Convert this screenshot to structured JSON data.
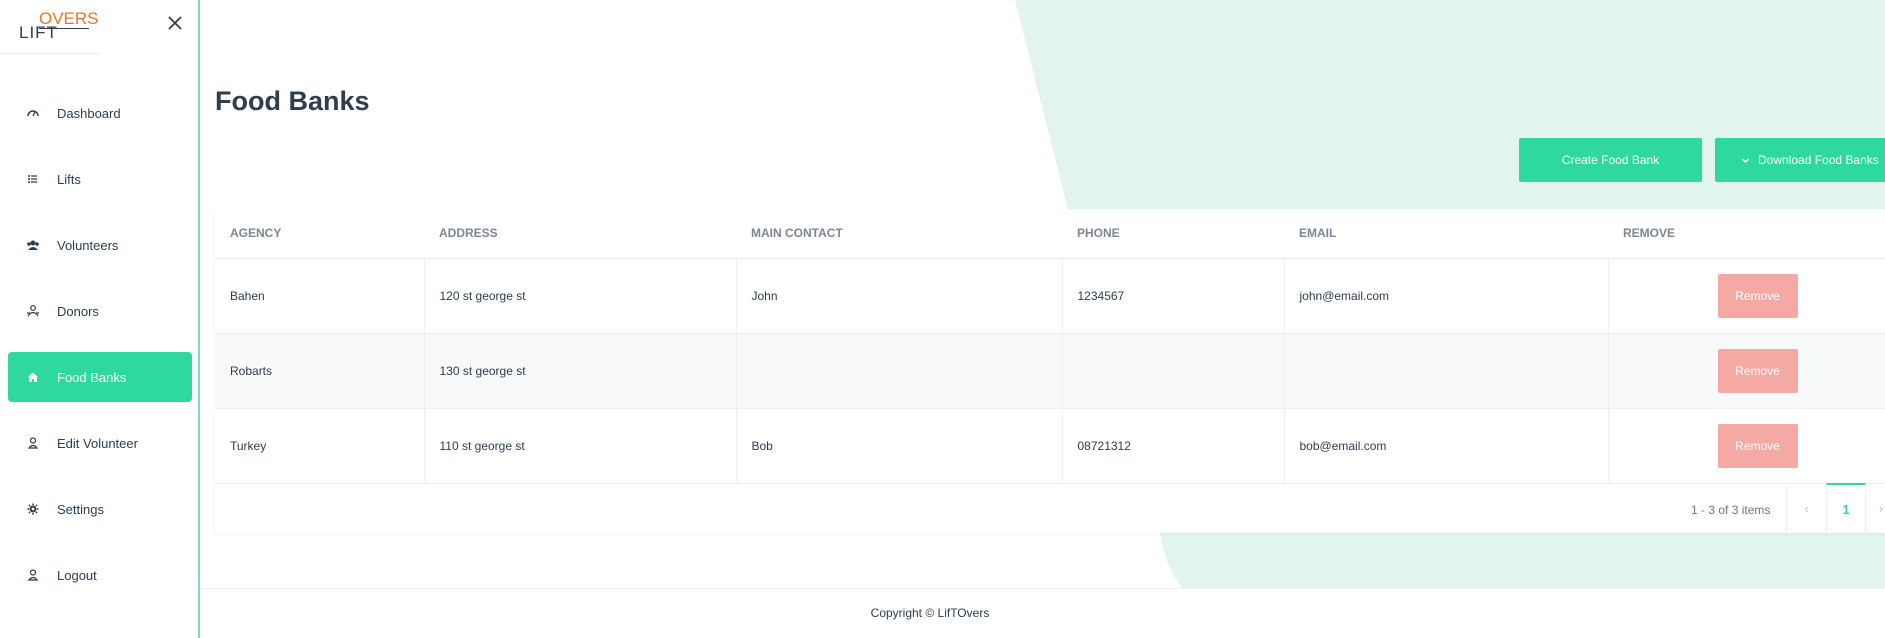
{
  "brand": {
    "logo_part1": "LIFT",
    "logo_part2": "OVERS"
  },
  "sidebar": {
    "items": [
      {
        "label": "Dashboard",
        "icon": "dashboard-icon"
      },
      {
        "label": "Lifts",
        "icon": "list-icon"
      },
      {
        "label": "Volunteers",
        "icon": "team-icon"
      },
      {
        "label": "Donors",
        "icon": "users-icon"
      },
      {
        "label": "Food Banks",
        "icon": "home-icon",
        "active": true
      },
      {
        "label": "Edit Volunteer",
        "icon": "user-icon"
      },
      {
        "label": "Settings",
        "icon": "gear-icon"
      },
      {
        "label": "Logout",
        "icon": "user-icon"
      }
    ]
  },
  "page": {
    "title": "Food Banks",
    "create_label": "Create Food Bank",
    "download_label": "Download Food Banks"
  },
  "table": {
    "columns": [
      "AGENCY",
      "ADDRESS",
      "MAIN CONTACT",
      "PHONE",
      "EMAIL",
      "REMOVE"
    ],
    "rows": [
      {
        "agency": "Bahen",
        "address": "120 st george st",
        "contact": "John",
        "phone": "1234567",
        "email": "john@email.com",
        "action": "Remove"
      },
      {
        "agency": "Robarts",
        "address": "130 st george st",
        "contact": "",
        "phone": "",
        "email": "",
        "action": "Remove"
      },
      {
        "agency": "Turkey",
        "address": "110 st george st",
        "contact": "Bob",
        "phone": "08721312",
        "email": "bob@email.com",
        "action": "Remove"
      }
    ]
  },
  "pagination": {
    "info": "1 - 3 of 3 items",
    "prev": "‹",
    "current": "1",
    "next": "›"
  },
  "footer": {
    "copyright": "Copyright © LifTOvers"
  },
  "colors": {
    "accent": "#2ed89f",
    "remove": "#f4a9a4",
    "text": "#2c3e50",
    "bg_shape": "#e1f5ee"
  }
}
